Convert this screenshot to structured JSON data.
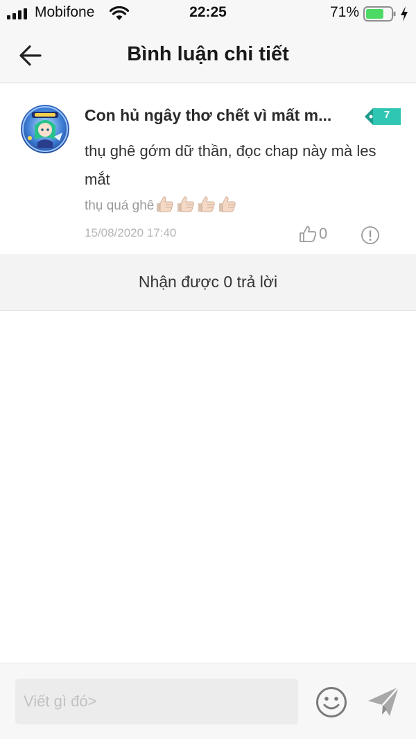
{
  "status_bar": {
    "carrier": "Mobifone",
    "time": "22:25",
    "battery_percent": "71%",
    "battery_level": 0.71,
    "icons": [
      "signal-icon",
      "wifi-icon",
      "battery-icon",
      "charging-icon"
    ]
  },
  "nav": {
    "title": "Bình luận chi tiết",
    "back_icon": "arrow-left-icon"
  },
  "comment": {
    "username": "Con hủ ngây thơ chết vì mất m...",
    "level": "7",
    "body": "thụ ghê gớm dữ thần, đọc chap này mà les mắt",
    "note": "thụ quá ghê",
    "thumbs_up_emoji_count": 4,
    "date": "15/08/2020 17:40",
    "likes": "0"
  },
  "replies": {
    "label": "Nhận được 0 trả lời"
  },
  "input": {
    "placeholder": "Viết gì đó>"
  },
  "colors": {
    "accent_teal": "#2fc6b3",
    "battery_green": "#4cd964",
    "background": "#ffffff",
    "bar_gray": "#f7f7f7"
  }
}
